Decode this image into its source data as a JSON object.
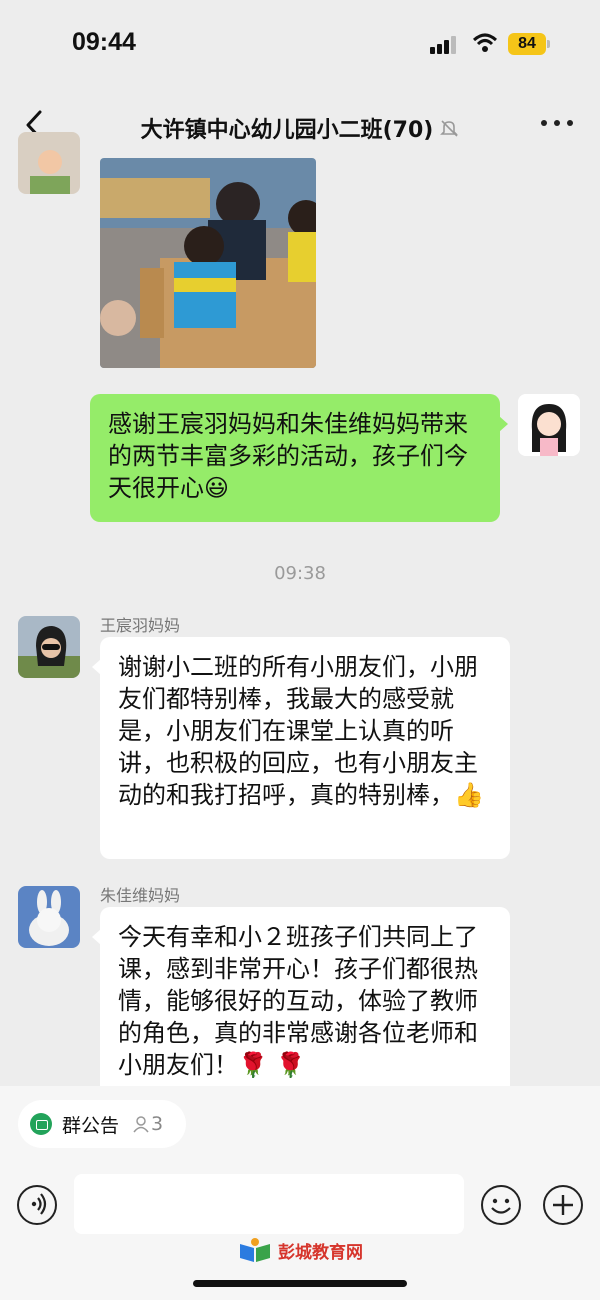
{
  "status_bar": {
    "time": "09:44",
    "battery": "84"
  },
  "header": {
    "title": "大许镇中心幼儿园小二班(70)",
    "icons": [
      "back-icon",
      "mute-icon",
      "more-icon"
    ]
  },
  "messages": {
    "self_message": {
      "text": "感谢王宸羽妈妈和朱佳维妈妈带来的两节丰富多彩的活动，孩子们今天很开心",
      "emoji": "😃"
    },
    "timestamp": "09:38",
    "msg1": {
      "sender": "王宸羽妈妈",
      "text": "谢谢小二班的所有小朋友们，小朋友们都特别棒，我最大的感受就是，小朋友们在课堂上认真的听讲，也积极的回应，也有小朋友主动的和我打招呼，真的特别棒，",
      "emoji": "👍"
    },
    "msg2": {
      "sender": "朱佳维妈妈",
      "text": "今天有幸和小２班孩子们共同上了课，感到非常开心！孩子们都很热情，能够很好的互动，体验了教师的角色，真的非常感谢各位老师和小朋友们！",
      "emoji": "🌹 🌹"
    }
  },
  "bottom": {
    "notice_label": "群公告",
    "notice_count": "3",
    "icons": [
      "voice-icon",
      "emoji-icon",
      "plus-icon"
    ]
  },
  "watermark": "彭城教育网",
  "colors": {
    "self_bubble": "#95ec69",
    "background": "#ededed",
    "battery": "#f5c518"
  }
}
